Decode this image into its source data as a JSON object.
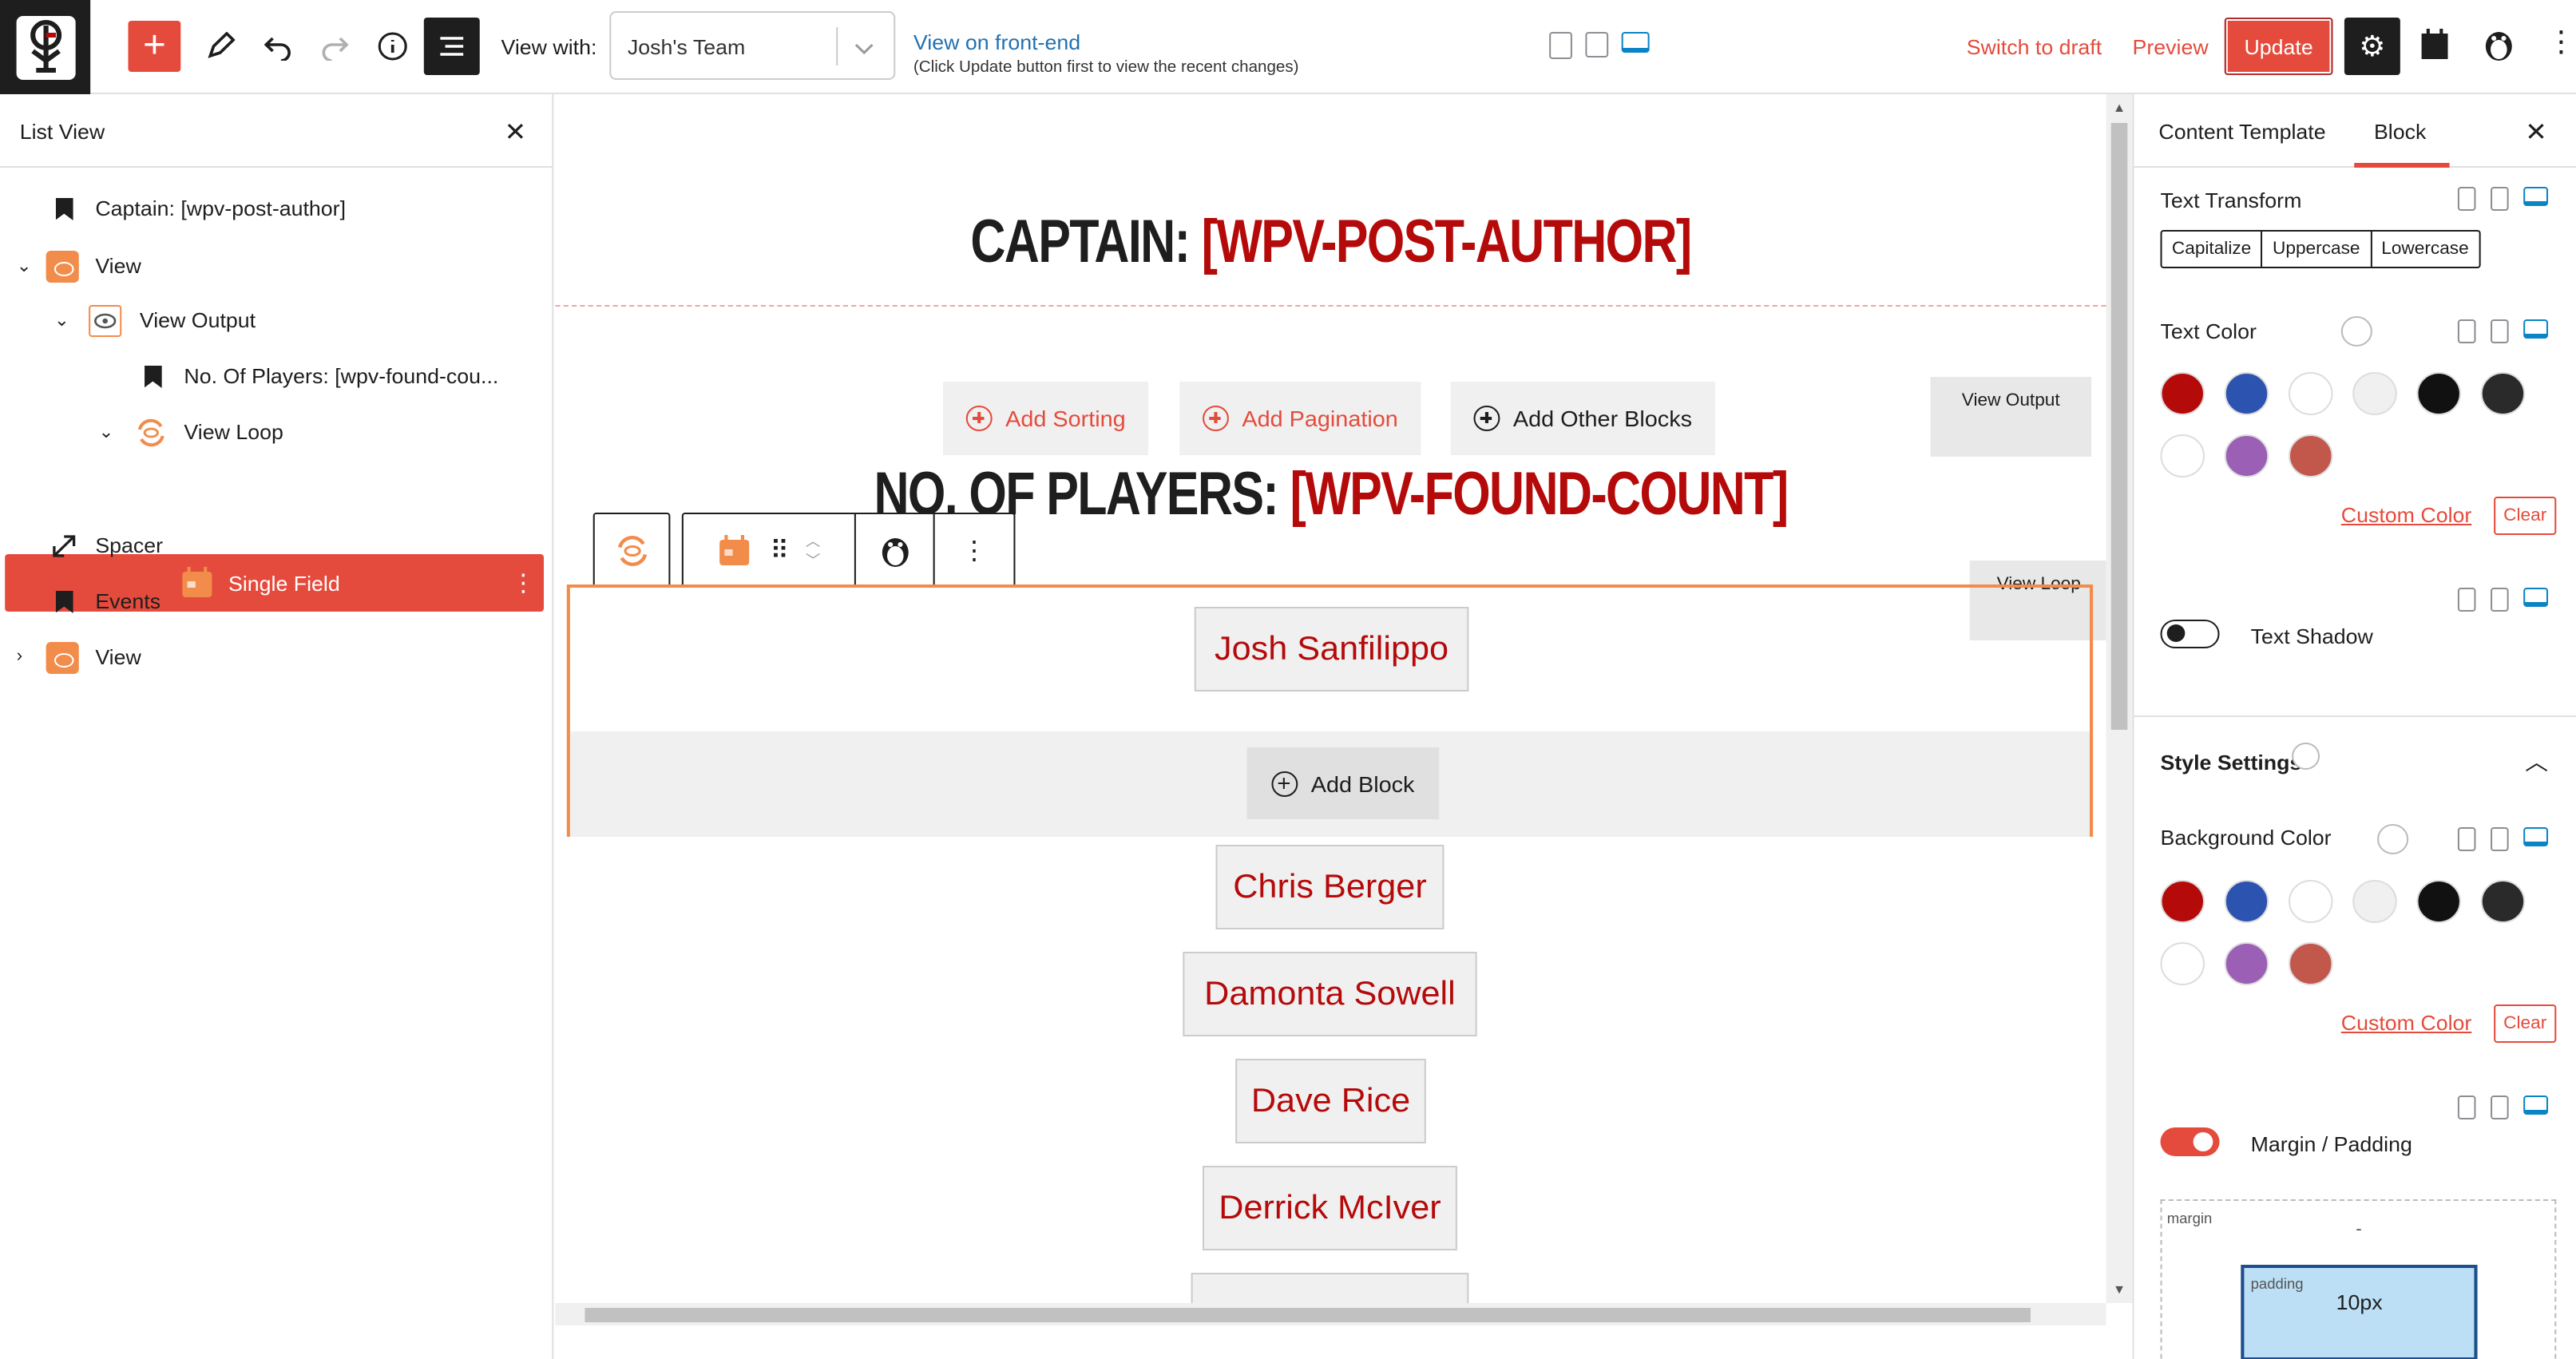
{
  "toolbar": {
    "view_with_label": "View with:",
    "view_with_value": "Josh's Team",
    "front_end_link": "View on front-end",
    "front_end_note": "(Click Update button first to view the recent changes)",
    "switch_to_draft": "Switch to draft",
    "preview": "Preview",
    "update": "Update",
    "add_icon": "plus-icon",
    "pen_icon": "pen-icon",
    "undo_icon": "undo-icon",
    "redo_icon": "redo-icon",
    "info_icon": "info-icon",
    "list_icon": "list-view-icon",
    "settings_icon": "gear-icon"
  },
  "list_view": {
    "title": "List View",
    "items": [
      {
        "label": "Captain: [wpv-post-author]"
      },
      {
        "label": "View"
      },
      {
        "label": "View Output"
      },
      {
        "label": "No. Of Players: [wpv-found-cou..."
      },
      {
        "label": "View Loop"
      },
      {
        "label": "Single Field"
      },
      {
        "label": "Spacer"
      },
      {
        "label": "Events"
      },
      {
        "label": "View"
      }
    ]
  },
  "canvas": {
    "heading1_prefix": "CAPTAIN: ",
    "heading1_shortcode": "[WPV-POST-AUTHOR]",
    "heading2_prefix": "NO. OF PLAYERS: ",
    "heading2_shortcode": "[WPV-FOUND-COUNT]",
    "add_sorting": "Add Sorting",
    "add_pagination": "Add Pagination",
    "add_other_blocks": "Add Other Blocks",
    "view_output_tag": "View Output",
    "view_loop_tag": "View Loop",
    "add_block": "Add Block",
    "players": [
      "Josh Sanfilippo",
      "Chris Berger",
      "Damonta Sowell",
      "Dave Rice",
      "Derrick McIver"
    ]
  },
  "right_panel": {
    "tab_content_template": "Content Template",
    "tab_block": "Block",
    "text_transform_label": "Text Transform",
    "text_transform_options": [
      "Capitalize",
      "Uppercase",
      "Lowercase"
    ],
    "text_color_label": "Text Color",
    "custom_color": "Custom Color",
    "clear": "Clear",
    "text_shadow_label": "Text Shadow",
    "style_settings_label": "Style Settings",
    "background_color_label": "Background Color",
    "margin_padding_label": "Margin / Padding",
    "margin_label": "margin",
    "margin_value": "-",
    "padding_label": "padding",
    "padding_value": "10px",
    "text_shadow_on": false,
    "margin_padding_on": true
  },
  "colors": {
    "accent": "#e54b3c",
    "palette": [
      "#b50a0a",
      "#2c53b0",
      "#ffffff",
      "#f0f0f0",
      "#111111",
      "#2a2a2a",
      "#ffffff",
      "#9b5fb5",
      "#c2574c"
    ]
  }
}
